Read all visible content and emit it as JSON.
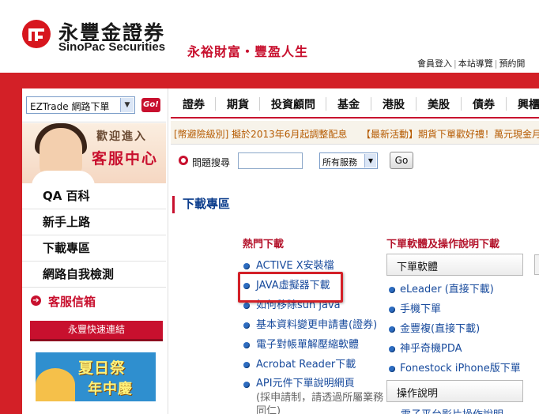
{
  "header": {
    "brand_cn": "永豐金證券",
    "brand_en": "SinoPac Securities",
    "slogan": "永裕財富・豐盈人生",
    "toplinks": [
      "會員登入",
      "本站導覽",
      "預約開"
    ]
  },
  "sidebar": {
    "ez_select_value": "EZTrade 網路下單",
    "go_label": "Go!",
    "cs_title_small": "歡迎進入",
    "cs_title_big": "客服中心",
    "items": [
      "QA 百科",
      "新手上路",
      "下載專區",
      "網路自我檢測"
    ],
    "mail_label": "客服信箱",
    "quick_link": "永豐快速連結",
    "promo_line1": "夏日祭",
    "promo_line2": "年中慶"
  },
  "tabs": [
    "證券",
    "期貨",
    "投資顧問",
    "基金",
    "港股",
    "美股",
    "債券",
    "興櫃"
  ],
  "ticker": {
    "item1": "[幣避險級別] 擬於2013年6月起調整配息",
    "item2": "【最新活動】期貨下單歡好禮！萬元現金月"
  },
  "search": {
    "label": "問題搜尋",
    "value": "",
    "scope": "所有服務",
    "go_label": "Go"
  },
  "section_title": "下載專區",
  "hot_downloads": {
    "heading": "熱門下載",
    "items": [
      "ACTIVE X安裝檔",
      "JAVA虛擬器下載",
      "如何移除sun java",
      "基本資料變更申請書(證券)",
      "電子對帳單解壓縮軟體",
      "Acrobat Reader下載",
      "API元件下單說明網頁"
    ],
    "note": "(採申請制，請透過所屬業務同仁)"
  },
  "trading_software": {
    "heading": "下單軟體及操作說明下載",
    "group1_title": "下單軟體",
    "group1_items": [
      "eLeader (直接下載)",
      "手機下單",
      "金豐複(直接下載)",
      "神乎奇機PDA",
      "Fonestock iPhone版下單"
    ],
    "group2_title": "操作說明",
    "group2_first": "電子平台影片操作說明"
  }
}
